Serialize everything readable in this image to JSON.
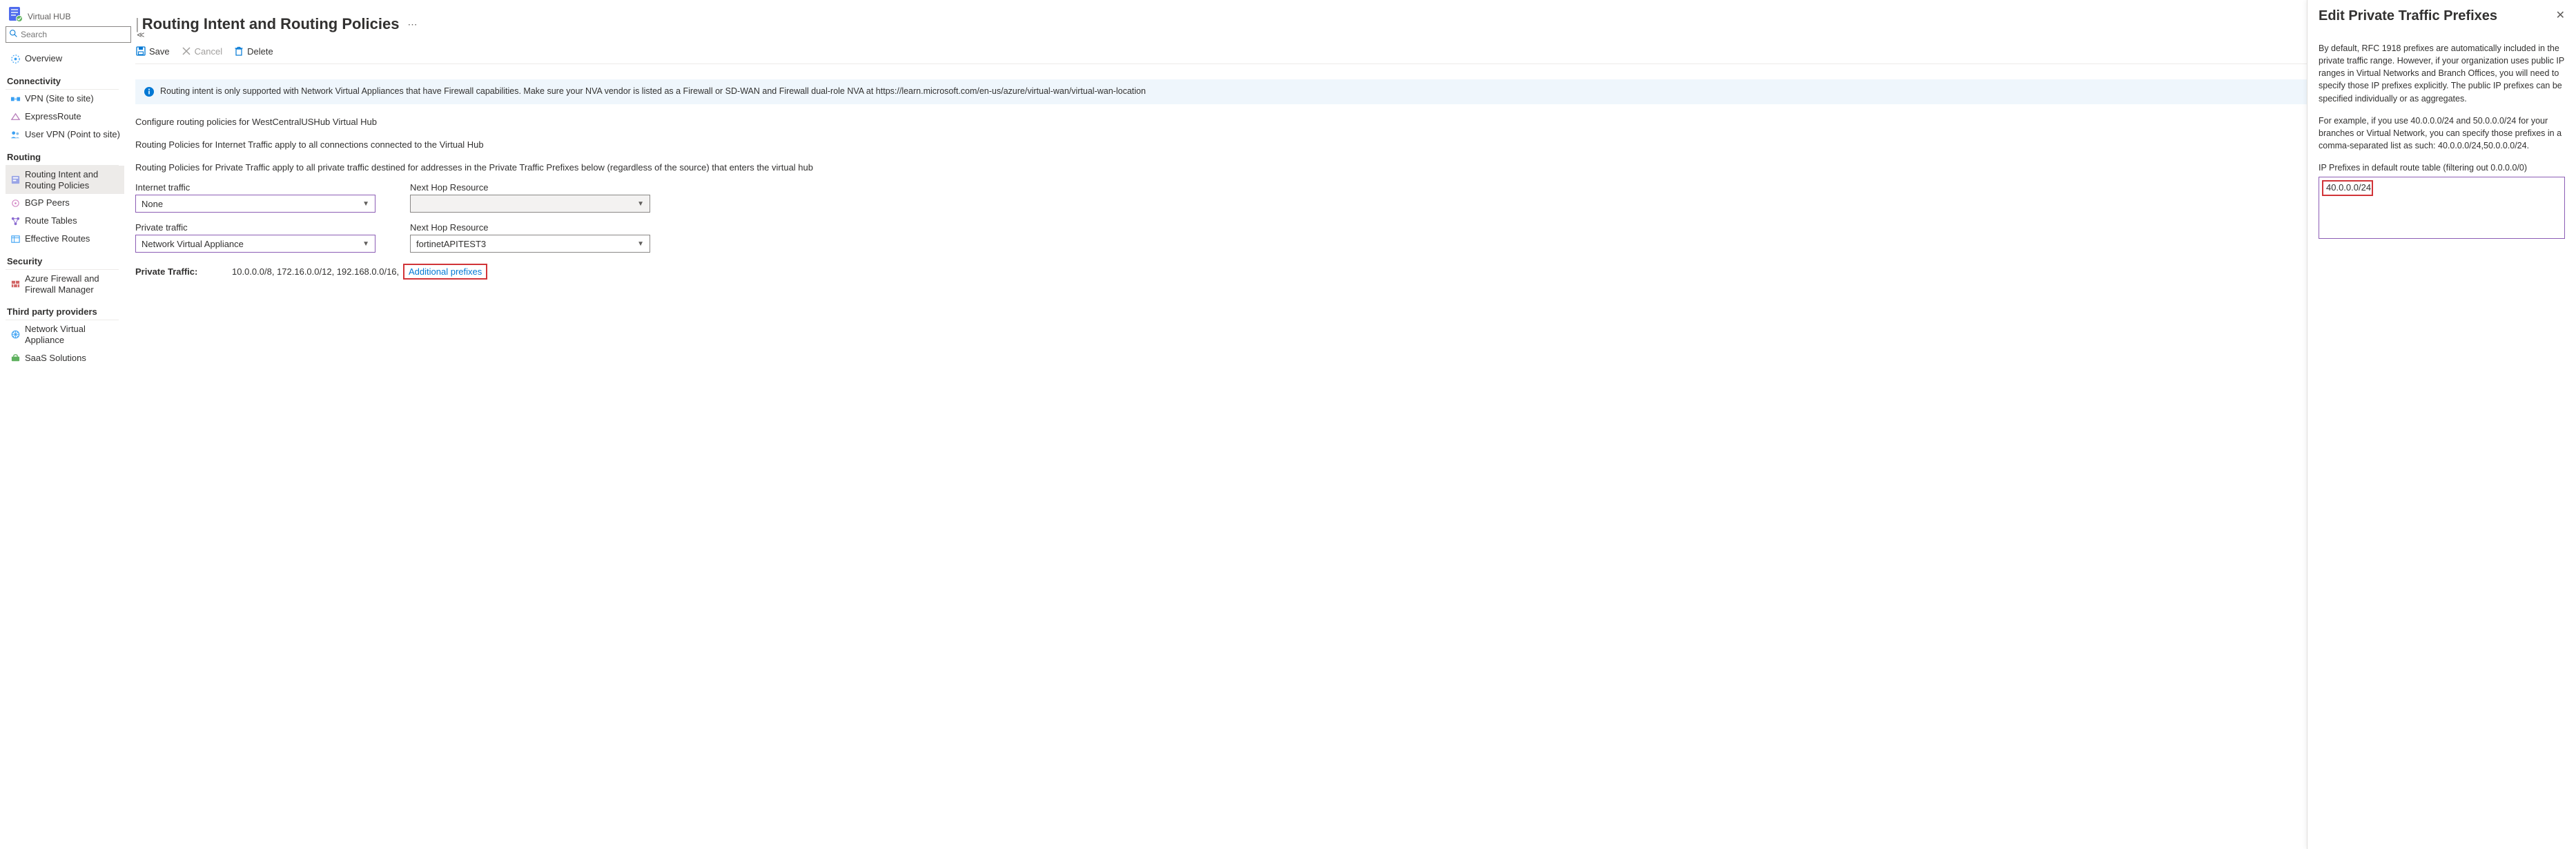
{
  "hub_name": "Virtual HUB",
  "search_placeholder": "Search",
  "sidebar": {
    "overview": "Overview",
    "sec_connectivity": "Connectivity",
    "vpn_s2s": "VPN (Site to site)",
    "expressroute": "ExpressRoute",
    "user_vpn": "User VPN (Point to site)",
    "sec_routing": "Routing",
    "routing_intent": "Routing Intent and Routing Policies",
    "bgp_peers": "BGP Peers",
    "route_tables": "Route Tables",
    "effective_routes": "Effective Routes",
    "sec_security": "Security",
    "azure_fw": "Azure Firewall and Firewall Manager",
    "sec_third": "Third party providers",
    "nva": "Network Virtual Appliance",
    "saas": "SaaS Solutions"
  },
  "page_title": "Routing Intent and Routing Policies",
  "toolbar": {
    "save": "Save",
    "cancel": "Cancel",
    "delete": "Delete"
  },
  "info_text": "Routing intent is only supported with Network Virtual Appliances that have Firewall capabilities. Make sure your NVA vendor is listed as a Firewall or SD-WAN and Firewall dual-role NVA at https://learn.microsoft.com/en-us/azure/virtual-wan/virtual-wan-location",
  "desc1": "Configure routing policies for WestCentralUSHub Virtual Hub",
  "desc2": "Routing Policies for Internet Traffic apply to all connections connected to the Virtual Hub",
  "desc3": "Routing Policies for Private Traffic apply to all private traffic destined for addresses in the Private Traffic Prefixes below (regardless of the source) that enters the virtual hub",
  "fields": {
    "internet_label": "Internet traffic",
    "internet_value": "None",
    "nexthop_label": "Next Hop Resource",
    "private_label": "Private traffic",
    "private_value": "Network Virtual Appliance",
    "nexthop2_value": "fortinetAPITEST3"
  },
  "private_traffic_label": "Private Traffic:",
  "private_traffic_value": "10.0.0.0/8, 172.16.0.0/12, 192.168.0.0/16,",
  "additional_link": "Additional prefixes",
  "panel": {
    "title": "Edit Private Traffic Prefixes",
    "p1": "By default, RFC 1918 prefixes are automatically included in the private traffic range. However, if your organization uses public IP ranges in Virtual Networks and Branch Offices, you will need to specify those IP prefixes explicitly. The public IP prefixes can be specified individually or as aggregates.",
    "p2": "For example, if you use 40.0.0.0/24 and 50.0.0.0/24 for your branches or Virtual Network, you can specify those prefixes in a comma-separated list as such: 40.0.0.0/24,50.0.0.0/24.",
    "label": "IP Prefixes in default route table (filtering out 0.0.0.0/0)",
    "value": "40.0.0.0/24"
  }
}
